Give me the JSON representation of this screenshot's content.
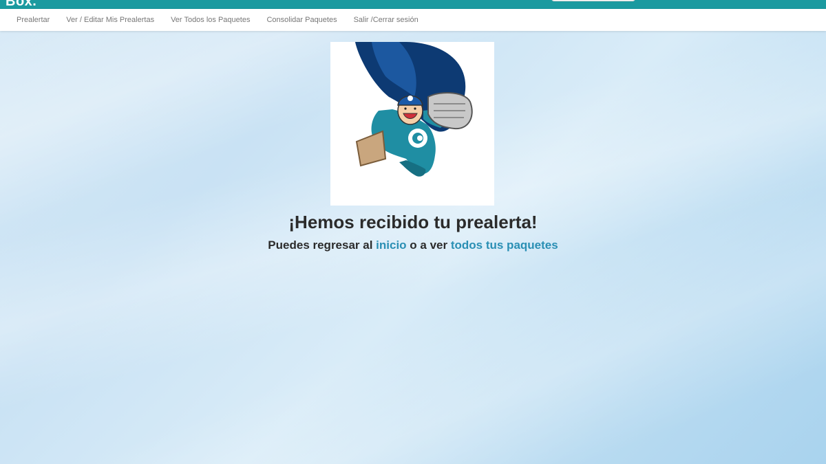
{
  "header": {
    "logo_text": "Box.",
    "accent_color": "#1b9aa0"
  },
  "nav": {
    "items": [
      {
        "label": "Prealertar"
      },
      {
        "label": "Ver / Editar Mis Prealertas"
      },
      {
        "label": "Ver Todos los Paquetes"
      },
      {
        "label": "Consolidar Paquetes"
      },
      {
        "label": "Salir /Cerrar sesión"
      }
    ]
  },
  "main": {
    "mascot_icon": "superhero-mascot-icon",
    "headline": "¡Hemos recibido tu prealerta!",
    "sub_prefix": "Puedes regresar al ",
    "link_home": "inicio",
    "sub_middle": " o a ver ",
    "link_packages": "todos tus paquetes",
    "link_color": "#2a8fb4"
  }
}
